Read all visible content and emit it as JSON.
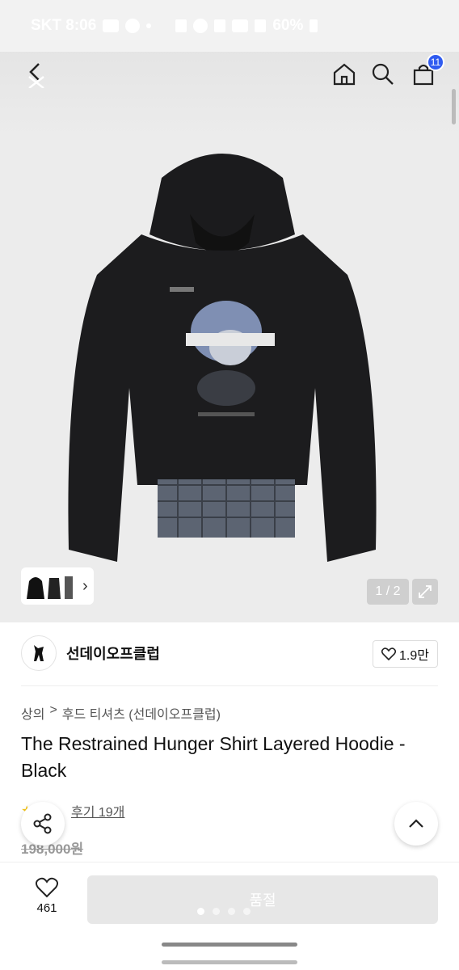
{
  "status_bar": {
    "carrier_time": "SKT 8:06",
    "battery": "60%"
  },
  "header": {
    "cart_count": "11"
  },
  "gallery": {
    "pager": "1 / 2"
  },
  "brand": {
    "name": "선데이오프클럽",
    "likes": "1.9만"
  },
  "product": {
    "breadcrumb": [
      "상의",
      ">",
      "후드 티셔츠 (선데이오프클럽)"
    ],
    "title": "The Restrained Hunger Shirt Layered Hoodie - Black",
    "reviews": "후기 19개",
    "original_price": "198,000원"
  },
  "bottom_bar": {
    "wishlist_count": "461",
    "status_button": "품절"
  },
  "colors": {
    "accent": "#2f5bf0",
    "hoodie": "#1c1c1e"
  }
}
